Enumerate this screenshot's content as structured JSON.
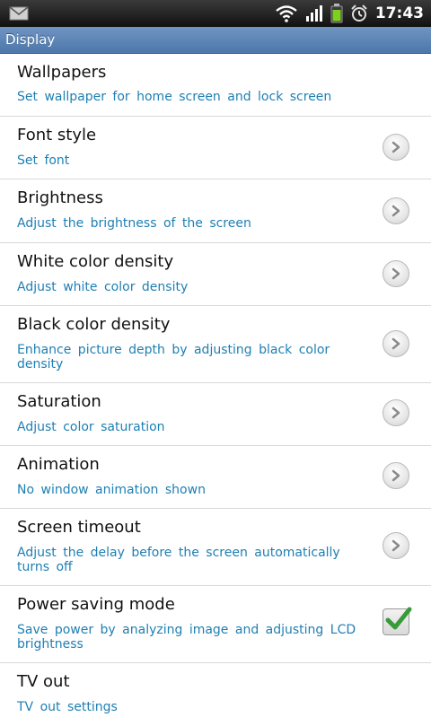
{
  "status_bar": {
    "time": "17:43",
    "icons": [
      "mail-icon",
      "wifi-icon",
      "signal-icon",
      "battery-icon",
      "alarm-icon"
    ]
  },
  "title_bar": {
    "title": "Display"
  },
  "colors": {
    "accent": "#1e7fb3",
    "title_bar": "#5a84b6",
    "check": "#3a9a3a"
  },
  "settings": [
    {
      "title": "Wallpapers",
      "subtitle": "Set wallpaper for home screen and lock screen",
      "control": "none"
    },
    {
      "title": "Font style",
      "subtitle": "Set font",
      "control": "chevron"
    },
    {
      "title": "Brightness",
      "subtitle": "Adjust the brightness of the screen",
      "control": "chevron"
    },
    {
      "title": "White color density",
      "subtitle": "Adjust white color density",
      "control": "chevron"
    },
    {
      "title": "Black color density",
      "subtitle": "Enhance picture depth by adjusting black color density",
      "control": "chevron"
    },
    {
      "title": "Saturation",
      "subtitle": "Adjust color saturation",
      "control": "chevron"
    },
    {
      "title": "Animation",
      "subtitle": "No window animation shown",
      "control": "chevron"
    },
    {
      "title": "Screen timeout",
      "subtitle": "Adjust the delay before the screen automatically turns off",
      "control": "chevron"
    },
    {
      "title": "Power saving mode",
      "subtitle": "Save power by analyzing image and adjusting LCD brightness",
      "control": "checkbox",
      "checked": true
    },
    {
      "title": "TV out",
      "subtitle": "TV out settings",
      "control": "none"
    }
  ]
}
